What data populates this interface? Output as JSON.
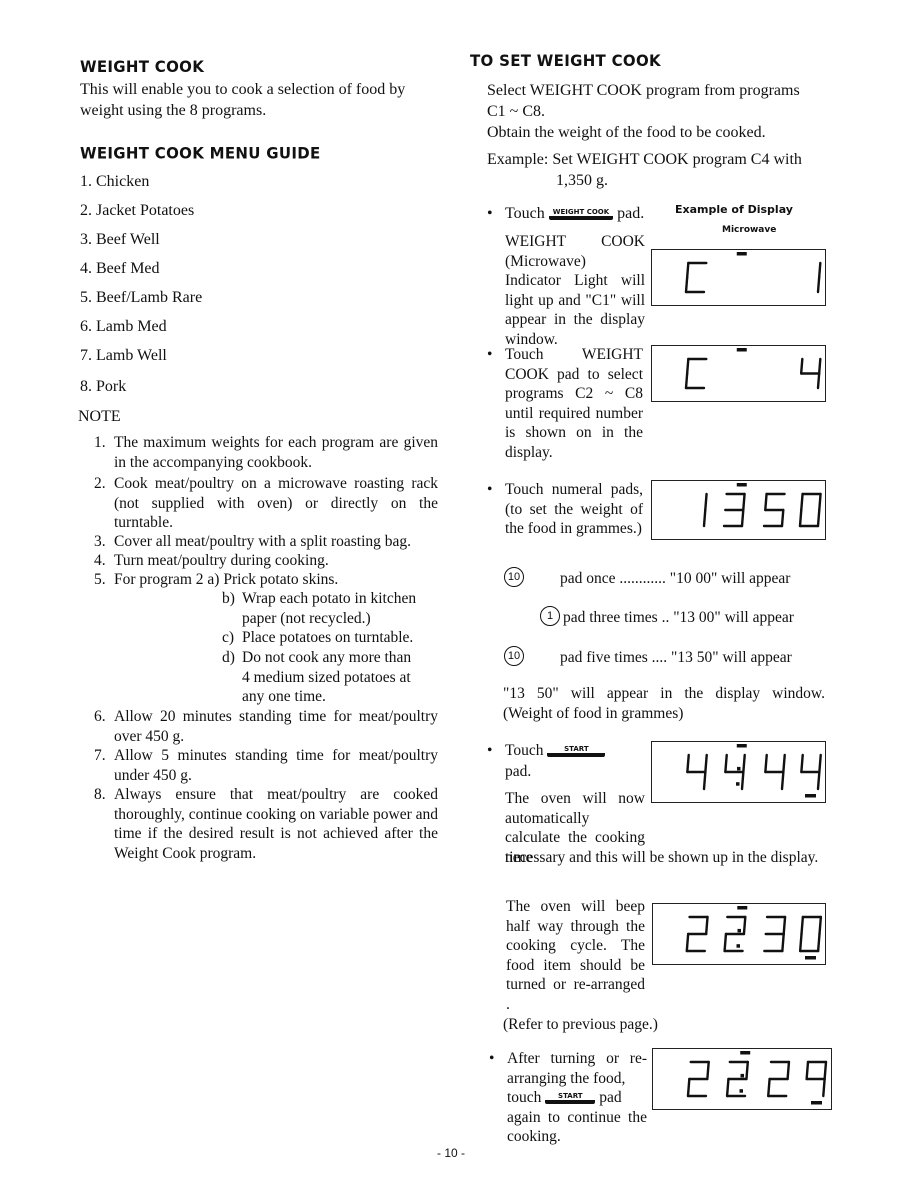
{
  "left": {
    "title": "WEIGHT COOK",
    "intro_line1": "This will enable you to cook a selection of food by",
    "intro_line2": "weight using the 8 programs.",
    "menu_title": "WEIGHT COOK MENU GUIDE",
    "menu": [
      {
        "num": "1.",
        "label": "Chicken"
      },
      {
        "num": "2.",
        "label": "Jacket Potatoes"
      },
      {
        "num": "3.",
        "label": "Beef Well"
      },
      {
        "num": "4.",
        "label": "Beef Med"
      },
      {
        "num": "5.",
        "label": "Beef/Lamb Rare"
      },
      {
        "num": "6.",
        "label": "Lamb Med"
      },
      {
        "num": "7.",
        "label": "Lamb Well"
      },
      {
        "num": "8.",
        "label": "Pork"
      }
    ],
    "note_title": "NOTE",
    "notes": [
      {
        "num": "1.",
        "text": "The maximum weights for each program are given in the accompanying cookbook."
      },
      {
        "num": "2.",
        "text": "Cook meat/poultry on a microwave roasting rack (not supplied with oven) or directly on the turntable."
      },
      {
        "num": "3.",
        "text": "Cover all meat/poultry with a split roasting bag."
      },
      {
        "num": "4.",
        "text": "Turn meat/poultry during cooking."
      },
      {
        "num": "5.",
        "text": "For program 2 a) Prick potato skins."
      },
      {
        "num": "6.",
        "text": "Allow 20 minutes standing time for meat/poultry over 450 g."
      },
      {
        "num": "7.",
        "text": "Allow 5 minutes standing time for meat/poultry under 450 g."
      },
      {
        "num": "8.",
        "text": "Always ensure that meat/poultry are cooked thoroughly, continue cooking on variable power and time if the desired result is not achieved after the Weight Cook program."
      }
    ],
    "note5_subs": [
      {
        "label": "b)",
        "text": "Wrap each potato in kitchen paper (not recycled.)"
      },
      {
        "label": "c)",
        "text": "Place potatoes on turntable."
      },
      {
        "label": "d)",
        "text": "Do not cook any more than 4 medium sized potatoes at any one time."
      }
    ]
  },
  "right": {
    "title": "TO SET WEIGHT COOK",
    "select_line1": "Select WEIGHT COOK program from programs",
    "select_line2": "C1 ~ C8.",
    "obtain": "Obtain the weight of the food to be cooked.",
    "example_line1": "Example: Set WEIGHT COOK program C4 with",
    "example_line2": "1,350 g.",
    "display_caption": "Example of Display",
    "display_sub": "Microwave",
    "step1": {
      "touch": "Touch",
      "pad_label": "WEIGHT COOK",
      "pad": "pad.",
      "text": "WEIGHT COOK (Microwave) Indicator Light will light up and \"C1\" will appear in the display window."
    },
    "step2": {
      "text": "Touch WEIGHT COOK pad to select programs C2 ~ C8 until required number is shown on in the display."
    },
    "step3": {
      "text": "Touch numeral pads, (to set the weight of the food in grammes.)"
    },
    "pad_steps": [
      {
        "key": "10",
        "text": "pad once ............ \"10 00\" will appear"
      },
      {
        "key": "1",
        "text": "pad three times .. \"13 00\" will appear"
      },
      {
        "key": "10",
        "text": "pad five times .... \"13 50\" will appear"
      }
    ],
    "result_line1": "\"13 50\" will appear in the display window.",
    "result_line2": "(Weight of food in grammes)",
    "step4": {
      "touch": "Touch",
      "pad_label": "START",
      "pad": "pad.",
      "text_a": "The oven will now automatically calculate the cooking time",
      "text_b": "necessary and this will be shown up in the display."
    },
    "beep_text": "The oven will beep half way through the cooking cycle. The food item should be turned or re-arranged .",
    "refer": "(Refer to previous page.)",
    "step5": {
      "text_a": "After turning or re-arranging the food,",
      "touch": "touch",
      "pad_label": "START",
      "pad": "pad",
      "text_b": "again to continue the cooking."
    }
  },
  "displays": [
    {
      "id": "c1",
      "digits": [
        "C",
        " ",
        " ",
        "1"
      ],
      "colon": false,
      "top_mark": true,
      "bottom_mark": false
    },
    {
      "id": "c4",
      "digits": [
        "C",
        " ",
        " ",
        "4"
      ],
      "colon": false,
      "top_mark": true,
      "bottom_mark": false
    },
    {
      "id": "1350",
      "digits": [
        "1",
        "3",
        "5",
        "0"
      ],
      "colon": false,
      "top_mark": true,
      "bottom_mark": false
    },
    {
      "id": "4444",
      "digits": [
        "4",
        "4",
        "4",
        "4"
      ],
      "colon": true,
      "top_mark": true,
      "bottom_mark": true
    },
    {
      "id": "2230",
      "digits": [
        "2",
        "2",
        "3",
        "0"
      ],
      "colon": true,
      "top_mark": true,
      "bottom_mark": true
    },
    {
      "id": "2229",
      "digits": [
        "2",
        "2",
        "2",
        "9"
      ],
      "colon": true,
      "top_mark": true,
      "bottom_mark": true
    }
  ],
  "page_number": "- 10 -"
}
